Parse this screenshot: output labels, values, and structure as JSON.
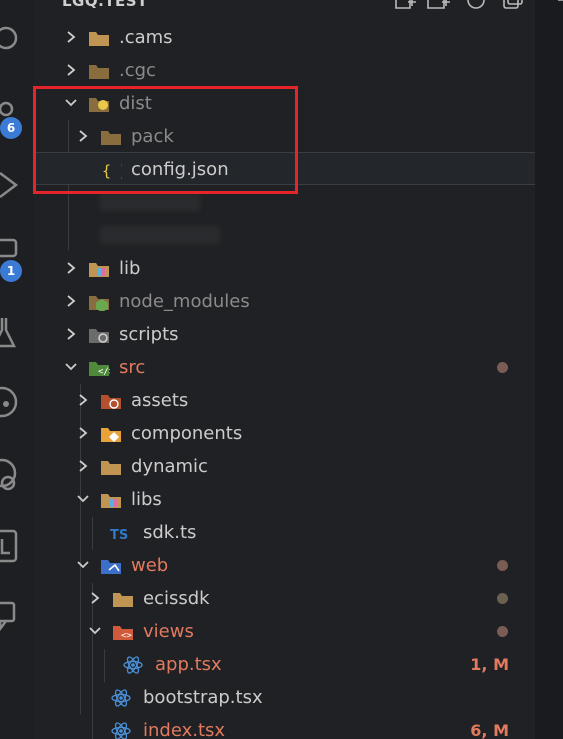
{
  "explorer": {
    "root_title": "LGQ.TEST"
  },
  "activity_bar": {
    "scm_badge": "6",
    "extensions_badge": "1"
  },
  "tree": [
    {
      "label": "cams_label",
      "text": ".cams"
    },
    {
      "text": ".cgc"
    }
  ],
  "rows": {
    "cams": ".cams",
    "cgc": ".cgc",
    "dist": "dist",
    "pack": "pack",
    "config": "config.json",
    "lib": "lib",
    "node_modules": "node_modules",
    "scripts": "scripts",
    "src": "src",
    "assets": "assets",
    "components": "components",
    "dynamic": "dynamic",
    "libs": "libs",
    "sdk": "sdk.ts",
    "web": "web",
    "ecissdk": "ecissdk",
    "views": "views",
    "app": "app.tsx",
    "app_status": "1, M",
    "bootstrap": "bootstrap.tsx",
    "index": "index.tsx",
    "index_status": "6, M"
  },
  "colors": {
    "modified": "#e27a5f",
    "highlight": "#e5252a",
    "folder": "#c09553",
    "badge": "#3a7bd5"
  }
}
